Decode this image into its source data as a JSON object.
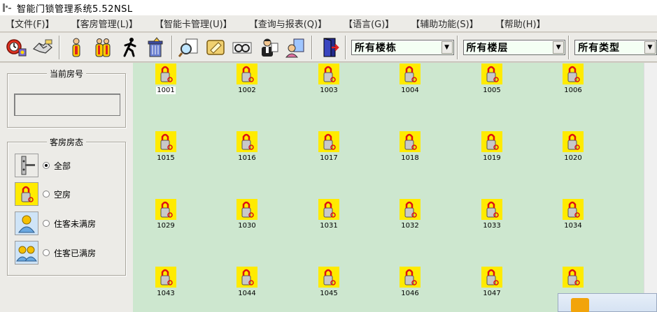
{
  "window": {
    "title": "智能门锁管理系统5.52NSL"
  },
  "menu": [
    "【文件(F)】",
    "【客房管理(L)】",
    "【智能卡管理(U)】",
    "【查询与报表(Q)】",
    "【语言(G)】",
    "【辅助功能(S)】",
    "【帮助(H)】"
  ],
  "toolbar": {
    "buttons": [
      {
        "name": "settings-clock-icon"
      },
      {
        "name": "handshake-icon"
      },
      {
        "name": "person-info-icon"
      },
      {
        "name": "group-info-icon"
      },
      {
        "name": "running-man-icon"
      },
      {
        "name": "trash-box-icon"
      },
      {
        "name": "magnifier-card-icon"
      },
      {
        "name": "card-reader-icon"
      },
      {
        "name": "glasses-icon"
      },
      {
        "name": "receptionist-icon"
      },
      {
        "name": "card-issue-icon"
      },
      {
        "name": "exit-door-icon"
      }
    ],
    "building_select": "所有楼栋",
    "floor_select": "所有楼层",
    "type_select": "所有类型"
  },
  "left_panel": {
    "current_room_title": "当前房号",
    "current_room_value": "",
    "status_title": "客房房态",
    "filters": [
      {
        "label": "全部",
        "icon": "door-handle-icon",
        "checked": true
      },
      {
        "label": "空房",
        "icon": "vacant-lock-icon",
        "checked": false
      },
      {
        "label": "住客未满房",
        "icon": "single-guest-icon",
        "checked": false
      },
      {
        "label": "住客已满房",
        "icon": "two-guests-icon",
        "checked": false
      }
    ]
  },
  "rooms": [
    [
      "1001",
      "1002",
      "1003",
      "1004",
      "1005",
      "1006"
    ],
    [
      "1015",
      "1016",
      "1017",
      "1018",
      "1019",
      "1020"
    ],
    [
      "1029",
      "1030",
      "1031",
      "1032",
      "1033",
      "1034"
    ],
    [
      "1043",
      "1044",
      "1045",
      "1046",
      "1047",
      ""
    ]
  ],
  "selected_room": "1001",
  "colors": {
    "grid_background": "#cde7cf",
    "room_icon_bg": "#ffeb00",
    "combo_background": "#f4fff4",
    "chrome": "#ecebe7"
  }
}
